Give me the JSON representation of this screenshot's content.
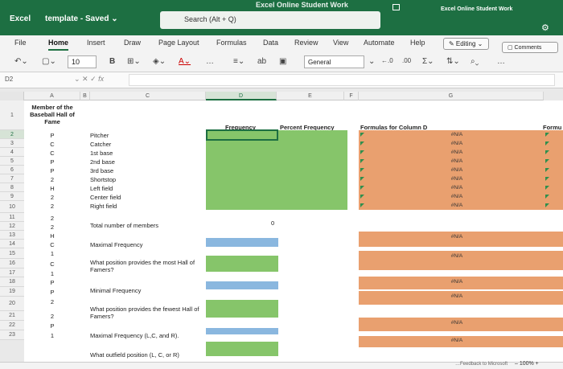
{
  "titlebar": {
    "app": "Excel",
    "doc": "template - Saved ⌄",
    "center": "Excel Online Student Work",
    "search_placeholder": "Search (Alt + Q)",
    "right": "Excel Online Student Work"
  },
  "tabs": [
    "File",
    "Home",
    "Insert",
    "Draw",
    "Page Layout",
    "Formulas",
    "Data",
    "Review",
    "View",
    "Automate",
    "Help"
  ],
  "editing_label": "✎ Editing ⌄",
  "comments_label": "▢ Comments",
  "toolbar": {
    "font_size": "10",
    "number_format": "General",
    "more": "…"
  },
  "name_box": "D2",
  "fx": "fx",
  "columns": [
    "A",
    "B",
    "C",
    "D",
    "E",
    "F",
    "G"
  ],
  "rows": [
    "1",
    "2",
    "3",
    "4",
    "5",
    "6",
    "7",
    "8",
    "9",
    "10",
    "11",
    "12",
    "13",
    "14",
    "15",
    "16",
    "17",
    "18",
    "19",
    "20",
    "21",
    "22",
    "23"
  ],
  "col_a_header": "Member of the Baseball Hall of Fame",
  "col_a_values": [
    "P",
    "C",
    "C",
    "P",
    "P",
    "2",
    "H",
    "2",
    "2",
    "2",
    "2",
    "H",
    "C",
    "1",
    "C",
    "1",
    "P",
    "P",
    "2",
    "2",
    "P",
    "1",
    "2"
  ],
  "positions": [
    "Pitcher",
    "Catcher",
    "1st base",
    "2nd base",
    "3rd base",
    "Shortstop",
    "Left field",
    "Center field",
    "Right field"
  ],
  "questions": {
    "total": "Total number of members",
    "maxfreq": "Maximal Frequency",
    "most_hof": "What position provides the most Hall of Famers?",
    "minfreq": "Minimal Frequency",
    "fewest_hof": "What position provides the fewest Hall of Famers?",
    "max_lcr": "Maximal Frequency (L,C, and R).",
    "outfield": "What outfield position (L, C, or R)"
  },
  "headers": {
    "frequency": "Frequency",
    "percent": "Percent Frequency",
    "formulas": "Formulas for Column D",
    "formu": "Formu"
  },
  "total_value": "0",
  "na": "#N/A",
  "zoom": "–  100%  +",
  "microsoft": "…Feedback to Microsoft"
}
